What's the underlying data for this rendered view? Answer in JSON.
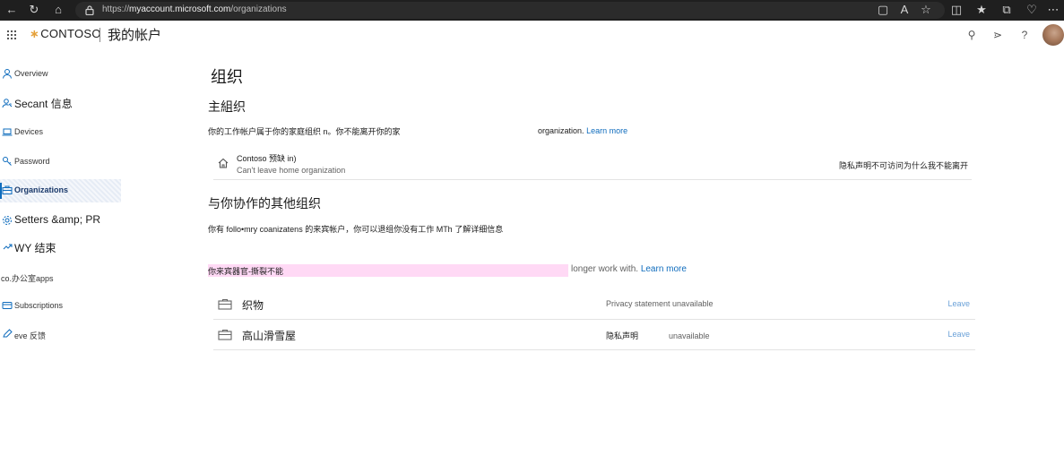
{
  "browser": {
    "url_scheme": "https://",
    "url_host": "myaccount.microsoft.com",
    "url_path": "/organizations"
  },
  "header": {
    "brand": "CONTOSO",
    "title": "我的帐户"
  },
  "sidebar": {
    "items": [
      {
        "label": "Overview",
        "icon": "person-icon"
      },
      {
        "label": "Secant 信息",
        "icon": "security-info-icon"
      },
      {
        "label": "Devices",
        "icon": "laptop-icon"
      },
      {
        "label": "Password",
        "icon": "key-icon"
      },
      {
        "label": "Organizations",
        "icon": "briefcase-icon",
        "active": true
      },
      {
        "label": "Setters &amp; PR",
        "icon": "gear-icon"
      },
      {
        "label": "WY 结束",
        "icon": "lock-icon"
      },
      {
        "label": "co.办公室apps",
        "icon": "apps-icon"
      },
      {
        "label": "Subscriptions",
        "icon": "card-icon"
      },
      {
        "label": "eve 反馈",
        "icon": "feedback-icon"
      }
    ]
  },
  "main": {
    "title": "组织",
    "home_section": {
      "heading": "主組织",
      "desc": "你的工作帐户属于你的家庭组织 n。你不能离开你的家",
      "desc_tail": "organization.",
      "learn_more": "Learn more",
      "org_name": "Contoso 预缺 in)",
      "org_sub": "Can't leave home organization",
      "privacy": "隐私声明不可访问为什么我不能离开"
    },
    "other_section": {
      "heading": "与你协作的其他组织",
      "desc": "你有 follo•mry  coanizatens 的来宾帐户，你可以退组你没有工作 MTh 了解详细信息",
      "highlight_text": "你来宾器官-撕裂不能",
      "highlight_tail": "longer work with.",
      "learn_more": "Learn more",
      "orgs": [
        {
          "name": "织物",
          "privacy": "Privacy statement unavailable",
          "leave": "Leave"
        },
        {
          "name": "高山滑雪屋",
          "privacy_zh": "隐私声明",
          "privacy_unav": "unavailable",
          "leave": "Leave"
        }
      ]
    }
  }
}
